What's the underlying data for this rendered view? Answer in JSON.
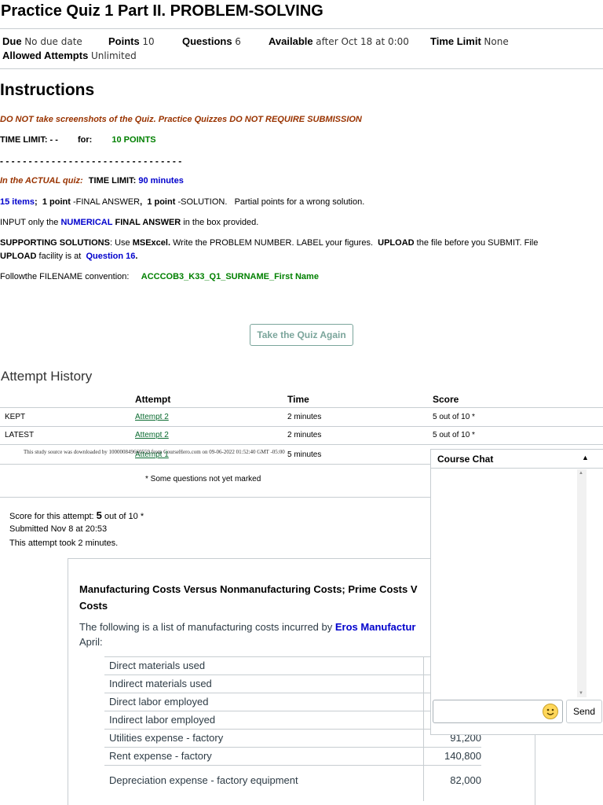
{
  "quiz": {
    "title": "Practice Quiz 1 Part II. PROBLEM-SOLVING"
  },
  "meta": {
    "due_label": "Due",
    "due_value": "No due date",
    "points_label": "Points",
    "points_value": "10",
    "questions_label": "Questions",
    "questions_value": "6",
    "available_label": "Available",
    "available_value": "after Oct 18 at 0:00",
    "time_limit_label": "Time Limit",
    "time_limit_value": "None",
    "attempts_label": "Allowed Attempts",
    "attempts_value": "Unlimited"
  },
  "instructions": {
    "heading": "Instructions",
    "line1": "DO NOT take screenshots of the Quiz.   Practice Quizzes DO NOT REQUIRE SUBMISSION",
    "line2_a": "TIME LIMIT:   - -",
    "line2_b": "for:",
    "line2_c": "10 POINTS",
    "separator": "- - - - - - - - - - - - - - - - - - - - - - - - - - - - - - - -",
    "line3_a": "In the ACTUAL quiz:",
    "line3_b": "TIME LIMIT:",
    "line3_c": "90 minutes",
    "line4_a": "15 items",
    "line4_b": ";",
    "line4_c": "1 point",
    "line4_d": "-FINAL ANSWER",
    "line4_e": ",",
    "line4_f": "1 point",
    "line4_g": "-SOLUTION.",
    "line4_h": "Partial points for a wrong solution.",
    "line5_a": "INPUT only the",
    "line5_b": "NUMERICAL",
    "line5_c": "FINAL ANSWER",
    "line5_d": "in the box provided.",
    "line6_a": "SUPPORTING SOLUTIONS",
    "line6_b": ":  Use",
    "line6_c": "MSExcel.",
    "line6_d": "Write the PROBLEM NUMBER.  LABEL your figures.",
    "line6_e": "UPLOAD",
    "line6_f": "the file before you SUBMIT.    File",
    "line7_a": "UPLOAD",
    "line7_b": "facility is at",
    "line7_c": "Question 16",
    "line7_d": ".",
    "line8_a": "Followthe FILENAME convention:",
    "line8_b": "ACCCOB3_K33_Q1_SURNAME_First Name"
  },
  "retake_button": "Take the Quiz Again",
  "history": {
    "heading": "Attempt History",
    "columns": [
      "Attempt",
      "Time",
      "Score"
    ],
    "rows": [
      {
        "label": "KEPT",
        "attempt": "Attempt 2",
        "time": "2 minutes",
        "score": "5 out of 10 *"
      },
      {
        "label": "LATEST",
        "attempt": "Attempt 2",
        "time": "2 minutes",
        "score": "5 out of 10 *"
      },
      {
        "label": "",
        "attempt": "Attempt 1",
        "time": "5 minutes",
        "score": ""
      }
    ],
    "footnote": "* Some questions not yet marked"
  },
  "watermark": "This study source was downloaded by 100000849660559 from CourseHero.com on 09-06-2022 01:52:40 GMT -05:00",
  "summary": {
    "score_label": "Score for this attempt:",
    "score_value": "5",
    "score_suffix": "out of 10 *",
    "submitted": "Submitted Nov 8 at 20:53",
    "duration": "This attempt took 2 minutes."
  },
  "question": {
    "title": "Manufacturing Costs Versus Nonmanufacturing Costs; Prime Costs V",
    "title_line2": "Costs",
    "intro_a": "The following is a list of manufacturing costs incurred by",
    "intro_company": "Eros Manufactur",
    "intro_b": "April:",
    "costs": [
      {
        "label": "Direct materials used",
        "value": ""
      },
      {
        "label": "Indirect materials used",
        "value": ""
      },
      {
        "label": "Direct labor employed",
        "value": ""
      },
      {
        "label": "Indirect labor employed",
        "value": ""
      },
      {
        "label": "Utilities expense - factory",
        "value": "91,200"
      },
      {
        "label": "Rent expense - factory",
        "value": "140,800"
      },
      {
        "label": "Depreciation expense - factory equipment",
        "value": "82,000"
      }
    ]
  },
  "chat": {
    "title": "Course Chat",
    "collapse_icon": "caret-up-icon",
    "send_label": "Send",
    "input_value": ""
  }
}
